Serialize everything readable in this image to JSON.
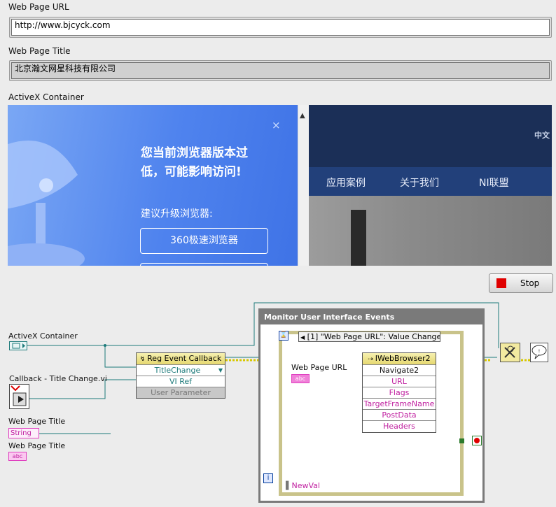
{
  "front_panel": {
    "url_label": "Web Page URL",
    "url_value": "http://www.bjcyck.com",
    "title_label": "Web Page Title",
    "title_value": "北京瀚文网星科技有限公司",
    "container_label": "ActiveX Container",
    "stop_label": "Stop"
  },
  "browser": {
    "popup_line1": "您当前浏览器版本过",
    "popup_line2": "低，可能影响访问!",
    "popup_hint": "建议升级浏览器:",
    "popup_button": "360极速浏览器",
    "close_glyph": "×",
    "site_nav": [
      "应用案例",
      "关于我们",
      "NI联盟"
    ],
    "site_corner": "中文"
  },
  "diagram": {
    "activex_label": "ActiveX Container",
    "callback_label": "Callback - Title Change.vi",
    "title_label_1": "Web Page Title",
    "title_label_2": "Web Page Title",
    "string_terminal": "String",
    "abc_terminal": "abc",
    "reg_node": {
      "header": "Reg Event Callback",
      "event": "TitleChange",
      "vi_ref": "VI Ref",
      "user_param": "User Parameter"
    },
    "while_loop_title": "Monitor User Interface Events",
    "event_case": "[1] \"Web Page URL\": Value Change",
    "url_label": "Web Page URL",
    "invoke_node": {
      "class": "IWebBrowser2",
      "method": "Navigate2",
      "params": [
        "URL",
        "Flags",
        "TargetFrameName",
        "PostData",
        "Headers"
      ]
    },
    "newval": "NewVal",
    "iter": "i"
  },
  "colors": {
    "string_wire": "#e040c0",
    "refnum_wire": "#1d7a7a",
    "cluster_wire": "#d8c800",
    "loop_border": "#7a7a7a"
  }
}
